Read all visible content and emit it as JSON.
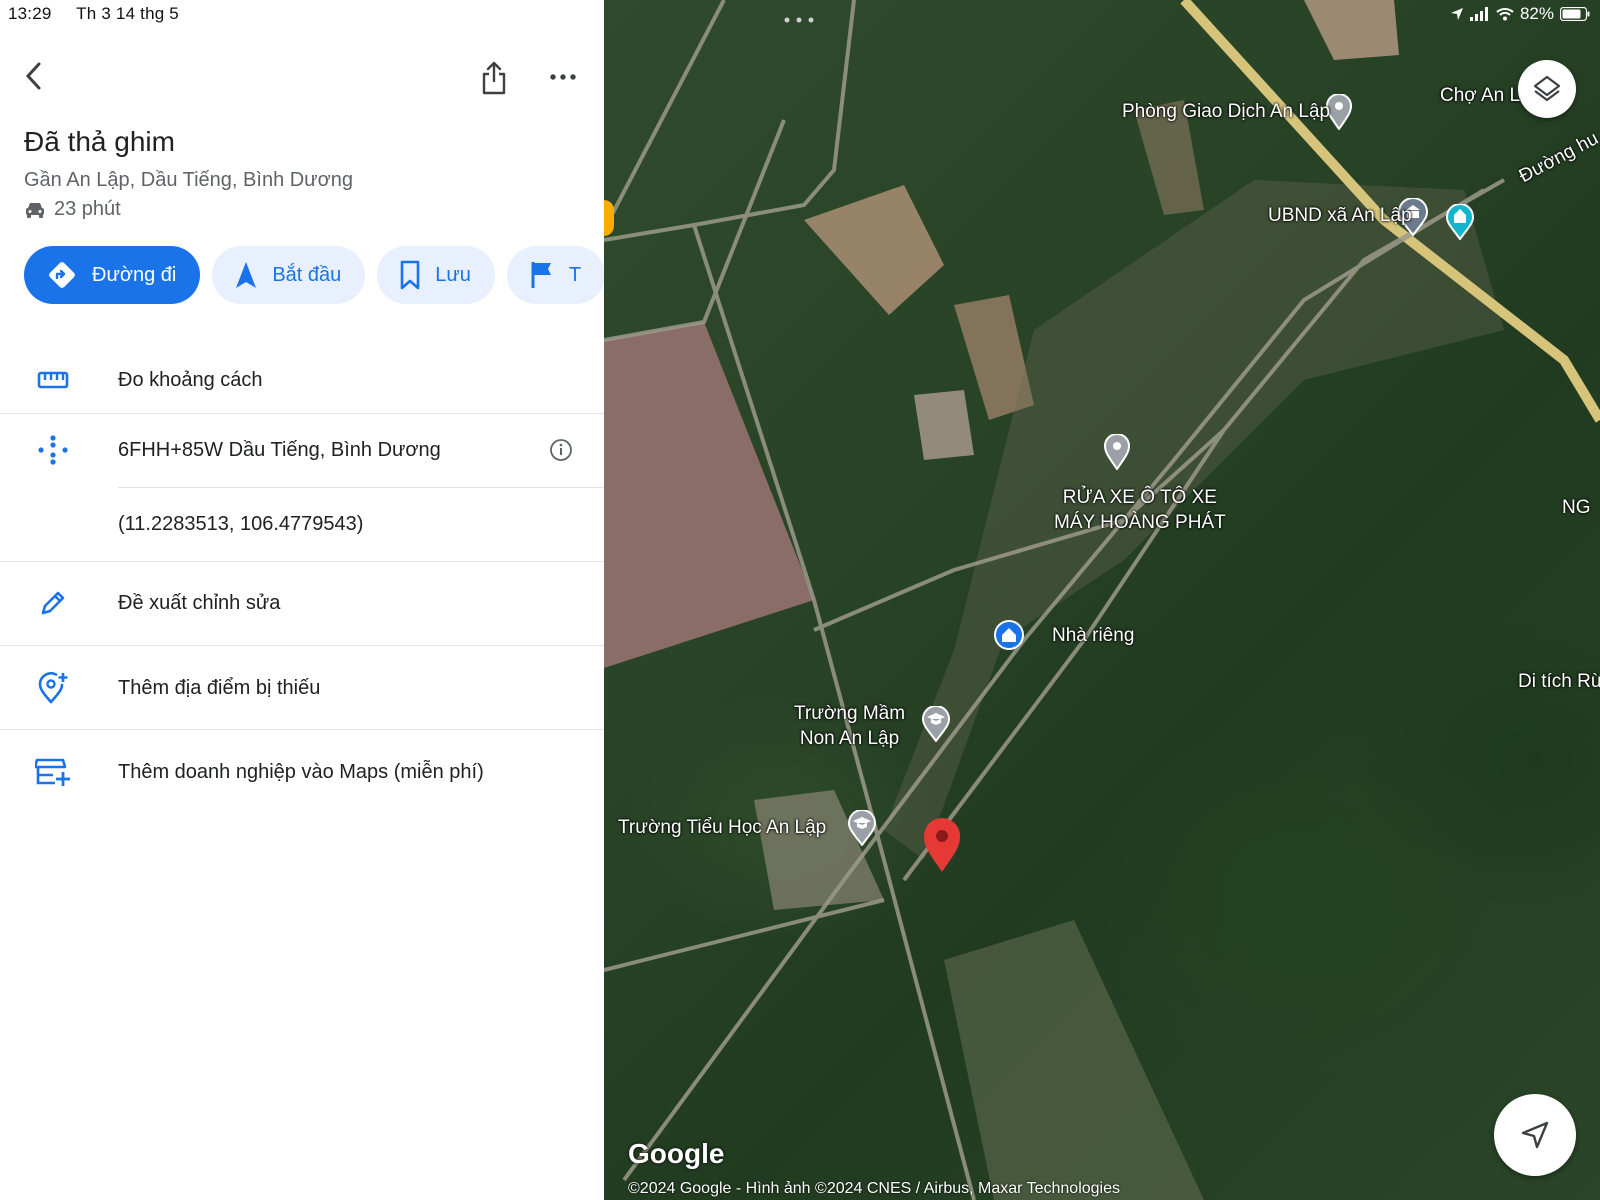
{
  "status_bar": {
    "time": "13:29",
    "date": "Th 3 14 thg 5",
    "battery": "82%"
  },
  "place": {
    "title": "Đã thả ghim",
    "subtitle": "Gần An Lập, Dầu Tiếng, Bình Dương",
    "drive_time": "23 phút"
  },
  "actions": [
    {
      "label": "Đường đi",
      "icon": "directions-icon"
    },
    {
      "label": "Bắt đầu",
      "icon": "navigation-arrow-icon"
    },
    {
      "label": "Lưu",
      "icon": "bookmark-icon"
    },
    {
      "label": "T",
      "icon": "flag-icon"
    }
  ],
  "rows": {
    "measure": "Đo khoảng cách",
    "plus_code": "6FHH+85W Dầu Tiếng, Bình Dương",
    "coordinates": "(11.2283513, 106.4779543)",
    "suggest_edit": "Đề xuất chỉnh sửa",
    "add_place": "Thêm địa điểm bị thiếu",
    "add_business": "Thêm doanh nghiệp vào Maps (miễn phí)"
  },
  "map": {
    "labels": {
      "phong_giao_dich": "Phòng Giao Dịch An Lập",
      "cho_an": "Chợ An L",
      "ubnd": "UBND xã An Lập",
      "duong": "Đường hu",
      "rua_xe": "RỬA XE Ô TÔ XE\nMÁY HOÀNG PHÁT",
      "nha_rieng": "Nhà riêng",
      "truong_mam_non": "Trường Mầm\nNon An Lập",
      "truong_tieu_hoc": "Trường Tiểu Học An Lập",
      "di_tich": "Di tích Rừ",
      "ng": "NG"
    },
    "logo": "Google",
    "copyright": "©2024 Google - Hình ảnh ©2024 CNES / Airbus, Maxar Technologies",
    "pin_color": "#e53935"
  }
}
